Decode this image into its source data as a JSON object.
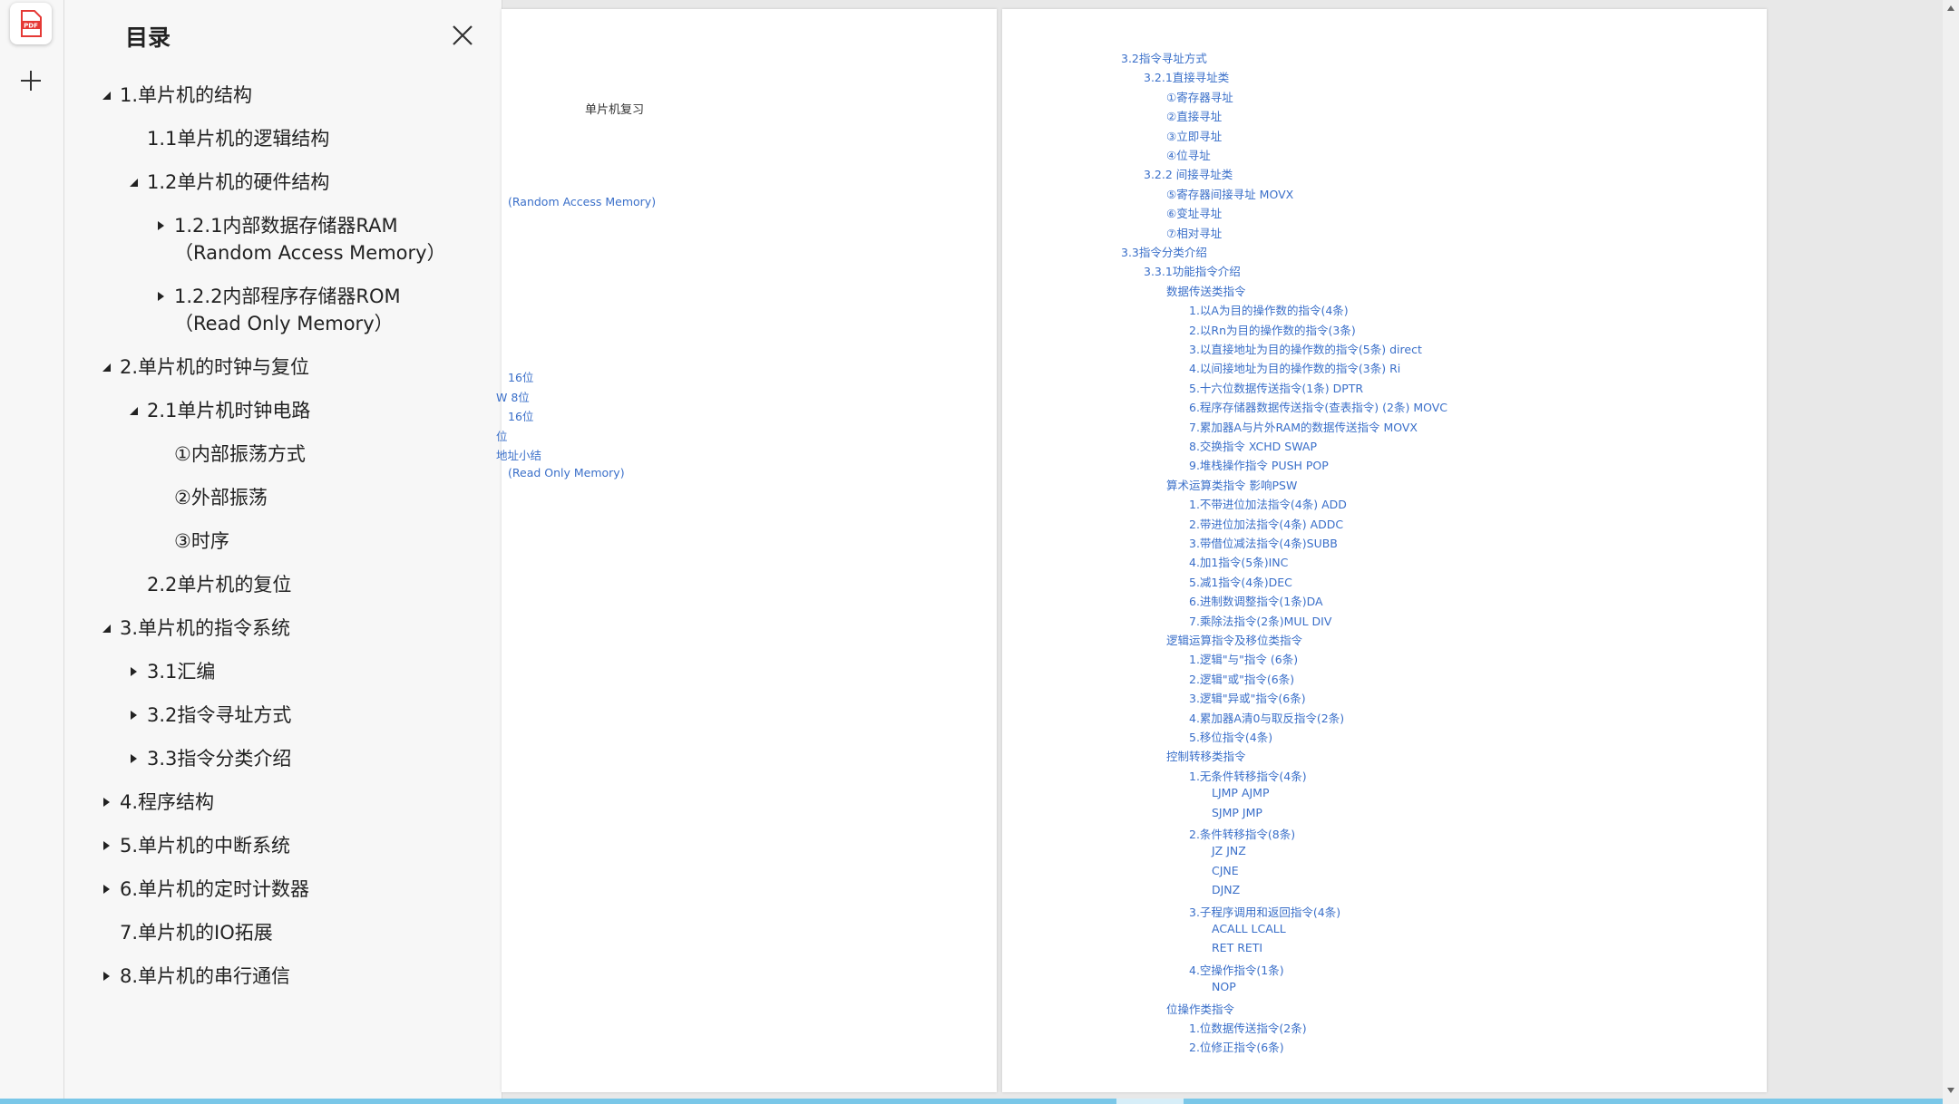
{
  "sidebar": {
    "pdf_icon_label": "PDF",
    "title": "目录"
  },
  "toc": [
    {
      "label": "1.单片机的结构",
      "level": 0,
      "state": "expanded"
    },
    {
      "label": "1.1单片机的逻辑结构",
      "level": 1,
      "state": "none"
    },
    {
      "label": "1.2单片机的硬件结构",
      "level": 1,
      "state": "expanded"
    },
    {
      "label": "1.2.1内部数据存储器RAM（Random Access Memory）",
      "level": 2,
      "state": "collapsed"
    },
    {
      "label": "1.2.2内部程序存储器ROM（Read Only Memory）",
      "level": 2,
      "state": "collapsed"
    },
    {
      "label": "2.单片机的时钟与复位",
      "level": 0,
      "state": "expanded"
    },
    {
      "label": "2.1单片机时钟电路",
      "level": 1,
      "state": "expanded"
    },
    {
      "label": "①内部振荡方式",
      "level": 2,
      "state": "none"
    },
    {
      "label": "②外部振荡",
      "level": 2,
      "state": "none"
    },
    {
      "label": "③时序",
      "level": 2,
      "state": "none"
    },
    {
      "label": "2.2单片机的复位",
      "level": 1,
      "state": "none"
    },
    {
      "label": "3.单片机的指令系统",
      "level": 0,
      "state": "expanded"
    },
    {
      "label": "3.1汇编",
      "level": 1,
      "state": "collapsed"
    },
    {
      "label": "3.2指令寻址方式",
      "level": 1,
      "state": "collapsed"
    },
    {
      "label": "3.3指令分类介绍",
      "level": 1,
      "state": "collapsed"
    },
    {
      "label": "4.程序结构",
      "level": 0,
      "state": "collapsed"
    },
    {
      "label": "5.单片机的中断系统",
      "level": 0,
      "state": "collapsed"
    },
    {
      "label": "6.单片机的定时计数器",
      "level": 0,
      "state": "collapsed"
    },
    {
      "label": "7.单片机的IO拓展",
      "level": 0,
      "state": "none"
    },
    {
      "label": "8.单片机的串行通信",
      "level": 0,
      "state": "collapsed"
    }
  ],
  "page_left": {
    "title": "单片机复习",
    "fragments": [
      "(Random Access Memory)",
      "16位",
      "W   8位",
      "16位",
      "位",
      "地址小结",
      "(Read Only Memory)"
    ]
  },
  "page_right": {
    "lines": [
      {
        "text": "3.2指令寻址方式",
        "indent": 0
      },
      {
        "text": "3.2.1直接寻址类",
        "indent": 1
      },
      {
        "text": "①寄存器寻址",
        "indent": 2
      },
      {
        "text": "②直接寻址",
        "indent": 2
      },
      {
        "text": "③立即寻址",
        "indent": 2
      },
      {
        "text": "④位寻址",
        "indent": 2
      },
      {
        "text": "3.2.2 间接寻址类",
        "indent": 1
      },
      {
        "text": "⑤寄存器间接寻址 MOVX",
        "indent": 2
      },
      {
        "text": "⑥变址寻址",
        "indent": 2
      },
      {
        "text": "⑦相对寻址",
        "indent": 2
      },
      {
        "text": "3.3指令分类介绍",
        "indent": 0
      },
      {
        "text": "3.3.1功能指令介绍",
        "indent": 1
      },
      {
        "text": "数据传送类指令",
        "indent": 2
      },
      {
        "text": "1.以A为目的操作数的指令(4条)",
        "indent": 3
      },
      {
        "text": "2.以Rn为目的操作数的指令(3条)",
        "indent": 3
      },
      {
        "text": "3.以直接地址为目的操作数的指令(5条) direct",
        "indent": 3
      },
      {
        "text": "4.以间接地址为目的操作数的指令(3条) Ri",
        "indent": 3
      },
      {
        "text": "5.十六位数据传送指令(1条) DPTR",
        "indent": 3
      },
      {
        "text": "6.程序存储器数据传送指令(查表指令) (2条)   MOVC",
        "indent": 3
      },
      {
        "text": "7.累加器A与片外RAM的数据传送指令 MOVX",
        "indent": 3
      },
      {
        "text": "8.交换指令 XCHD SWAP",
        "indent": 3
      },
      {
        "text": "9.堆栈操作指令     PUSH POP",
        "indent": 3
      },
      {
        "text": "算术运算类指令 影响PSW",
        "indent": 2
      },
      {
        "text": "1.不带进位加法指令(4条) ADD",
        "indent": 3
      },
      {
        "text": "2.带进位加法指令(4条) ADDC",
        "indent": 3
      },
      {
        "text": "3.带借位减法指令(4条)SUBB",
        "indent": 3
      },
      {
        "text": "4.加1指令(5条)INC",
        "indent": 3
      },
      {
        "text": "5.减1指令(4条)DEC",
        "indent": 3
      },
      {
        "text": "6.进制数调整指令(1条)DA",
        "indent": 3
      },
      {
        "text": "7.乘除法指令(2条)MUL DIV",
        "indent": 3
      },
      {
        "text": "逻辑运算指令及移位类指令",
        "indent": 2
      },
      {
        "text": "1.逻辑\"与\"指令 (6条)",
        "indent": 3
      },
      {
        "text": "2.逻辑\"或\"指令(6条)",
        "indent": 3
      },
      {
        "text": "3.逻辑\"异或\"指令(6条)",
        "indent": 3
      },
      {
        "text": "4.累加器A清0与取反指令(2条)",
        "indent": 3
      },
      {
        "text": "5.移位指令(4条)",
        "indent": 3
      },
      {
        "text": "控制转移类指令",
        "indent": 2
      },
      {
        "text": "1.无条件转移指令(4条)",
        "indent": 3
      },
      {
        "text": "LJMP AJMP",
        "indent": 4
      },
      {
        "text": "SJMP JMP",
        "indent": 4
      },
      {
        "text": "2.条件转移指令(8条)",
        "indent": 3
      },
      {
        "text": "JZ JNZ",
        "indent": 4
      },
      {
        "text": "CJNE",
        "indent": 4
      },
      {
        "text": "DJNZ",
        "indent": 4
      },
      {
        "text": "3.子程序调用和返回指令(4条)",
        "indent": 3
      },
      {
        "text": "ACALL LCALL",
        "indent": 4
      },
      {
        "text": "RET RETI",
        "indent": 4
      },
      {
        "text": "4.空操作指令(1条)",
        "indent": 3
      },
      {
        "text": "NOP",
        "indent": 4
      },
      {
        "text": "位操作类指令",
        "indent": 2
      },
      {
        "text": "1.位数据传送指令(2条)",
        "indent": 3
      },
      {
        "text": "2.位修正指令(6条)",
        "indent": 3
      }
    ]
  }
}
